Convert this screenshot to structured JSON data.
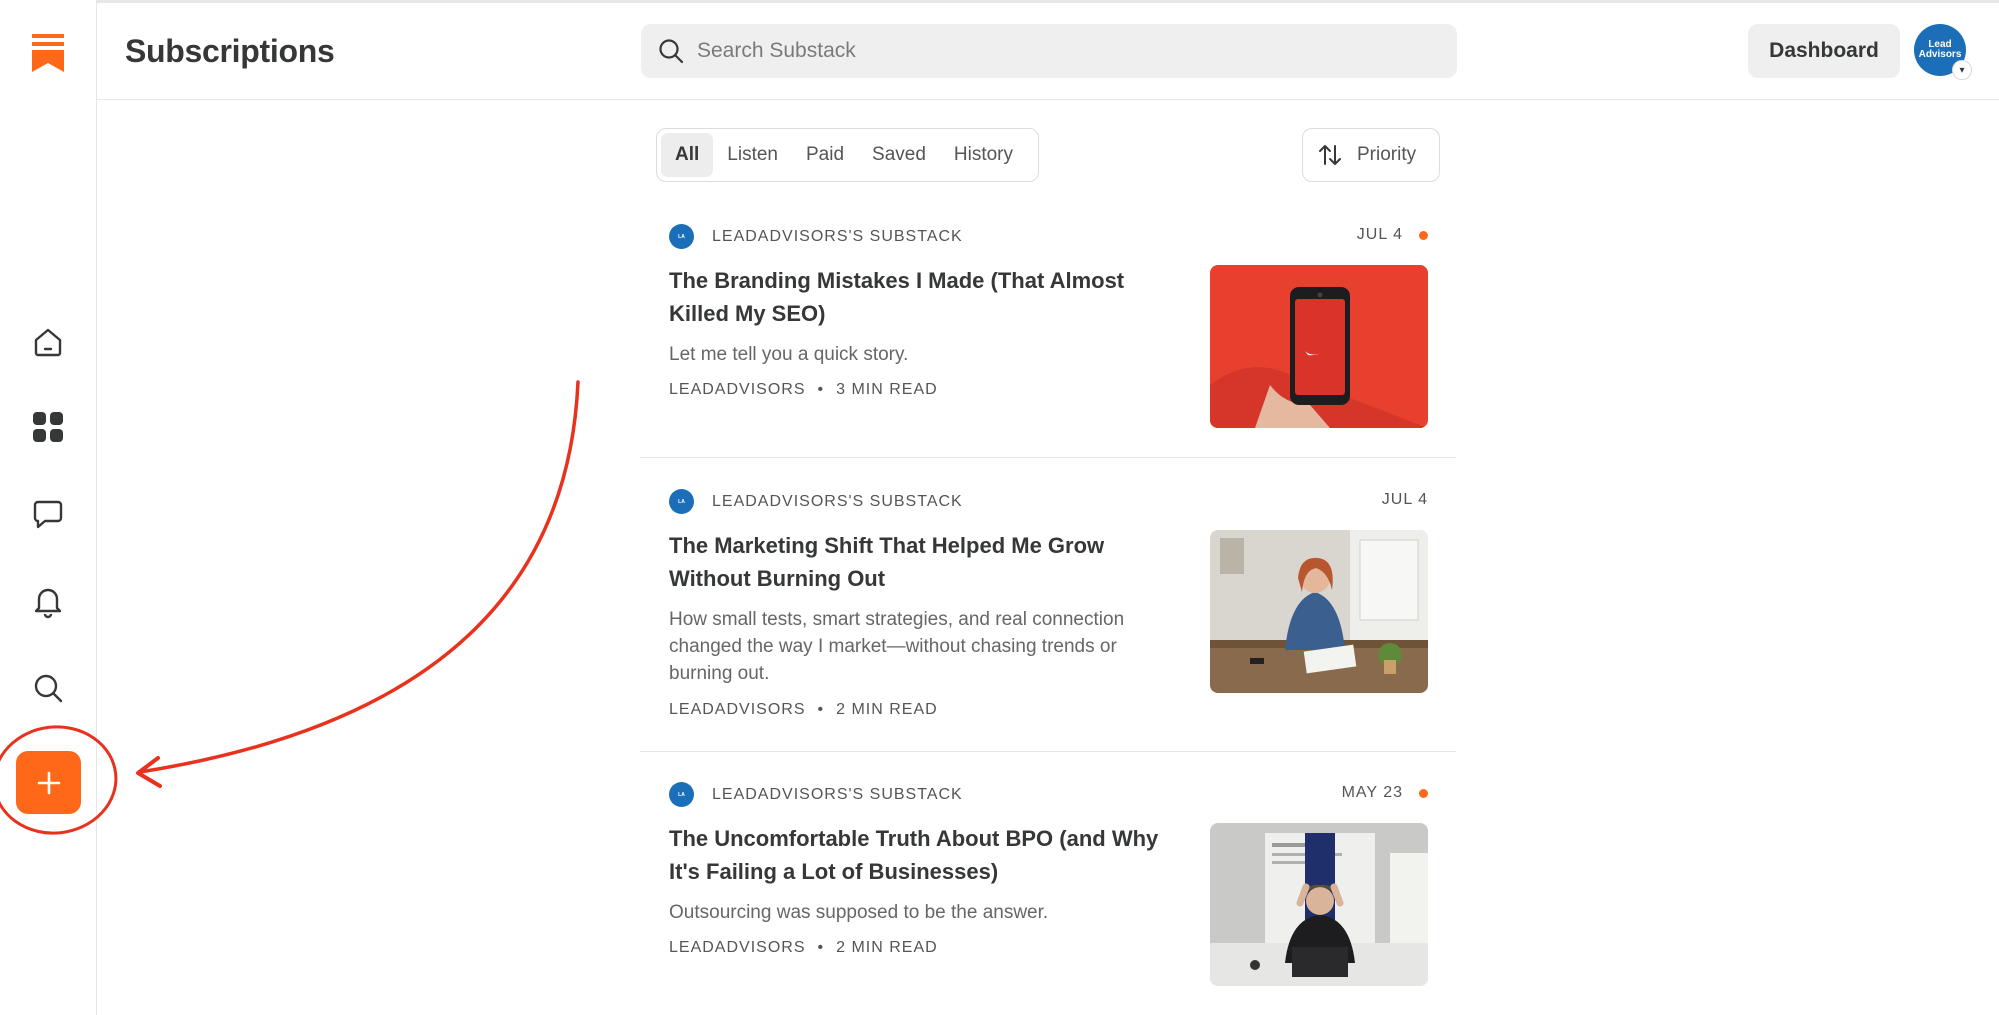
{
  "header": {
    "title": "Subscriptions",
    "search_placeholder": "Search Substack",
    "dashboard_label": "Dashboard",
    "avatar_text": "Lead Advisors"
  },
  "sidebar": {
    "items": [
      {
        "name": "home",
        "icon": "home-icon"
      },
      {
        "name": "apps",
        "icon": "grid-icon"
      },
      {
        "name": "chat",
        "icon": "chat-bubble-icon"
      },
      {
        "name": "activity",
        "icon": "bell-icon"
      },
      {
        "name": "search",
        "icon": "search-icon"
      }
    ],
    "create_icon": "plus-icon"
  },
  "filters": {
    "tabs": [
      "All",
      "Listen",
      "Paid",
      "Saved",
      "History"
    ],
    "active": "All",
    "sort_label": "Priority"
  },
  "posts": [
    {
      "publication": "LEADADVISORS'S SUBSTACK",
      "date": "JUL 4",
      "unread": true,
      "title": "The Branding Mistakes I Made (That Almost Killed My SEO)",
      "subtitle": "Let me tell you a quick story.",
      "author": "LEADADVISORS",
      "read_time": "3 MIN READ"
    },
    {
      "publication": "LEADADVISORS'S SUBSTACK",
      "date": "JUL 4",
      "unread": false,
      "title": "The Marketing Shift That Helped Me Grow Without Burning Out",
      "subtitle": "How small tests, smart strategies, and real connection changed the way I market—without chasing trends or burning out.",
      "author": "LEADADVISORS",
      "read_time": "2 MIN READ"
    },
    {
      "publication": "LEADADVISORS'S SUBSTACK",
      "date": "MAY 23",
      "unread": true,
      "title": "The Uncomfortable Truth About BPO (and Why It's Failing a Lot of Businesses)",
      "subtitle": "Outsourcing was supposed to be the answer.",
      "author": "LEADADVISORS",
      "read_time": "2 MIN READ"
    }
  ],
  "meta_separator": "•",
  "colors": {
    "accent": "#ff6719",
    "annotation": "#e8321e",
    "publication_blue": "#1a6fb8"
  }
}
